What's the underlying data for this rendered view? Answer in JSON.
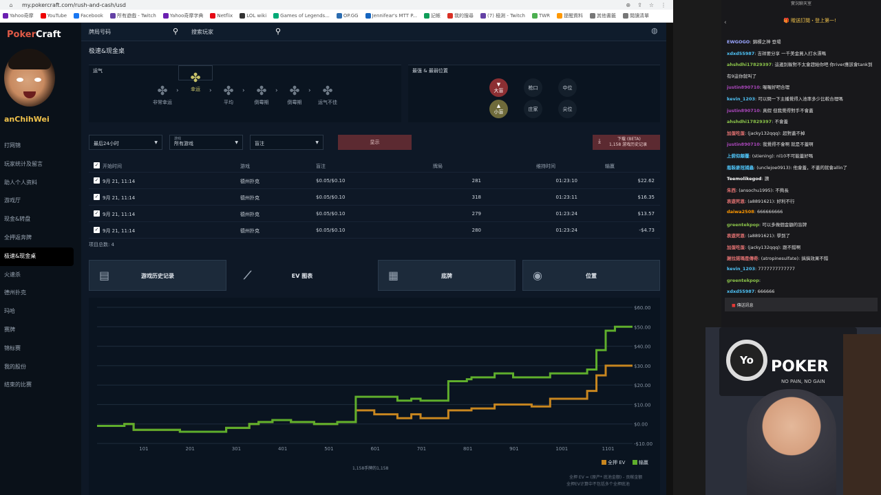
{
  "browser": {
    "url": "my.pokercraft.com/rush-and-cash/usd",
    "bookmarks": [
      "Yahoo奇摩",
      "YouTube",
      "Facebook",
      "所有遊戲 - Twitch",
      "Yahoo奇摩字典",
      "Netflix",
      "LOL wiki",
      "Games of Legends...",
      "OP.GG",
      "Jennifear's MTT P...",
      "記帳",
      "我的搜尋",
      "(7) 極測 - Twitch",
      "TWR",
      "提醒資料",
      "其他書籤",
      "閱讀清單"
    ]
  },
  "app": {
    "logo_a": "Poker",
    "logo_b": "Craft",
    "username": "anChihWei",
    "sidebar": [
      {
        "label": "打网锦"
      },
      {
        "label": "玩家统计及留言"
      },
      {
        "label": "助人个人资料"
      },
      {
        "label": "游戏厅"
      },
      {
        "label": "现金&转盘"
      },
      {
        "label": "全押返奔牌"
      },
      {
        "label": "极速&现金桌",
        "active": true
      },
      {
        "label": "火速杀"
      },
      {
        "label": "德州扑克"
      },
      {
        "label": "玛哈"
      },
      {
        "label": "赛牌"
      },
      {
        "label": "锦标赛"
      },
      {
        "label": "我的股份"
      },
      {
        "label": "结束的比赛"
      }
    ],
    "topbar": {
      "hand_number": "牌局号码",
      "search_player": "搜索玩家"
    },
    "page_title": "极速&现金桌",
    "luck": {
      "title": "运气",
      "steps": [
        "非常幸运",
        "幸运",
        "平均",
        "倒霉期",
        "倒霉期",
        "运气不佳"
      ],
      "selected_index": 1
    },
    "positions": {
      "title": "最强 & 最弱位置",
      "big_blind": "大盲",
      "small_blind": "小盲",
      "cutoff": "枪口",
      "middle": "中位",
      "dealer": "庄家",
      "utg": "尖位"
    },
    "filters": {
      "period": "最后24小时",
      "game_small": "游戏",
      "game": "所有游戏",
      "stakes": "盲注",
      "show": "显示",
      "download_a": "下载 (BETA)",
      "download_b": "1,158 游戏历史记录"
    },
    "table": {
      "headers": [
        "开始时间",
        "游戏",
        "盲注",
        "牌局",
        "维持时间",
        "输赢"
      ],
      "rows": [
        {
          "start": "9月 21, 11:14",
          "game": "德州扑克",
          "stakes": "$0.05/$0.10",
          "hands": "281",
          "duration": "01:23:10",
          "result": "$22.62"
        },
        {
          "start": "9月 21, 11:14",
          "game": "德州扑克",
          "stakes": "$0.05/$0.10",
          "hands": "318",
          "duration": "01:23:11",
          "result": "$16.35"
        },
        {
          "start": "9月 21, 11:14",
          "game": "德州扑克",
          "stakes": "$0.05/$0.10",
          "hands": "279",
          "duration": "01:23:24",
          "result": "$13.57"
        },
        {
          "start": "9月 21, 11:14",
          "game": "德州扑克",
          "stakes": "$0.05/$0.10",
          "hands": "280",
          "duration": "01:23:24",
          "result": "-$4.73"
        }
      ],
      "count": "项目总数: 4"
    },
    "tabs": [
      "游戏历史记录",
      "EV 图表",
      "底牌",
      "位置"
    ],
    "tab_icons": [
      "history-icon",
      "chart-icon",
      "grid-icon",
      "position-icon"
    ],
    "active_tab": 1
  },
  "chart_data": {
    "type": "line",
    "xlabel": "1,158手牌的1,158",
    "ylabel": "",
    "x_ticks": [
      "101",
      "201",
      "301",
      "401",
      "501",
      "601",
      "701",
      "801",
      "901",
      "1001",
      "1101"
    ],
    "y_ticks": [
      "$60.00",
      "$50.00",
      "$40.00",
      "$30.00",
      "$20.00",
      "$10.00",
      "$0.00",
      "-$10.00"
    ],
    "ylim": [
      -10,
      60
    ],
    "xlim": [
      1,
      1158
    ],
    "grid": true,
    "legend_position": "bottom-right",
    "colors": {
      "ev": "#c8861f",
      "winnings": "#5fae2c"
    },
    "series": [
      {
        "name": "全押 EV",
        "x": [
          1,
          60,
          80,
          180,
          280,
          330,
          350,
          380,
          420,
          470,
          520,
          560,
          600,
          650,
          680,
          700,
          760,
          800,
          810,
          860,
          900,
          940,
          980,
          1020,
          1060,
          1080,
          1100,
          1120,
          1158
        ],
        "values": [
          -1,
          0,
          -3,
          -4,
          -2,
          0,
          1,
          2,
          1,
          0,
          1,
          7,
          5,
          3,
          5,
          3,
          7,
          7,
          8,
          10,
          10,
          9,
          13,
          13,
          17,
          25,
          30,
          30,
          30
        ]
      },
      {
        "name": "输赢",
        "x": [
          1,
          60,
          80,
          180,
          280,
          330,
          350,
          380,
          420,
          470,
          520,
          560,
          600,
          650,
          680,
          700,
          760,
          800,
          810,
          860,
          900,
          940,
          980,
          1020,
          1060,
          1080,
          1100,
          1120,
          1158
        ],
        "values": [
          -1,
          0,
          -3,
          -4,
          -2,
          0,
          1,
          2,
          1,
          0,
          1,
          14,
          14,
          12,
          13,
          12,
          22,
          23,
          24,
          26,
          24,
          24,
          26,
          26,
          28,
          38,
          48,
          50,
          50
        ]
      }
    ],
    "footnote_a": "全押 EV = (原产* 底池金额) - 贡献金额",
    "footnote_b": "全押EV计算中不包括多个全押底池",
    "y_values_note": ""
  },
  "stream": {
    "chat_title": "實況聊天室",
    "gift_text": "贈送訂閱・登上第一!",
    "messages": [
      {
        "user": "EWGOGO",
        "text": "錦標之神 登場",
        "color": "#9aa6ff"
      },
      {
        "user": "xdxd55987",
        "text": "吉祥要分享 一千美金買入打水漂嗎",
        "color": "#4fc3f7"
      },
      {
        "user": "ahshdhi17829397",
        "text": "這邊別躲對不太會趕給你吧 你river應該會tank到",
        "color": "#8bc34a"
      },
      {
        "user": "",
        "text": "有9這你就叫了",
        "color": "#fff"
      },
      {
        "user": "justin890710",
        "text": "喔喔好吧合理",
        "color": "#ab47bc"
      },
      {
        "user": "kevin_1203",
        "text": "可以問一下主播覺得入池率多少比較合理嗎",
        "color": "#4fc3f7"
      },
      {
        "user": "justin890710",
        "text": "真假 但我覺得對手不會蓋",
        "color": "#ab47bc"
      },
      {
        "user": "ahshdhi17829397",
        "text": "不會蓋",
        "color": "#8bc34a"
      },
      {
        "user": "加蛋吃蛋",
        "text": "(jacky132qqq): 超對蓋不掉",
        "color": "#e57373"
      },
      {
        "user": "justin890710",
        "text": "我覺得不會啊 就是不蓋啊",
        "color": "#ab47bc"
      },
      {
        "user": "上俯仰顛覆",
        "text": "(stiening): nl10不可能蓋好嗎",
        "color": "#4fc3f7"
      },
      {
        "user": "瓶裝麥冠捕蟲",
        "text": "(unclejoe0913): 他會蓋，不蓋的就會allin了",
        "color": "#4fc3f7"
      },
      {
        "user": "Teemolikegod",
        "text": "讚",
        "color": "#fff"
      },
      {
        "user": "朱西",
        "text": "(ansochu1995): 不夠長",
        "color": "#e57373"
      },
      {
        "user": "哀遊死恩",
        "text": "(a8891621): 好利不行",
        "color": "#e57373"
      },
      {
        "user": "daiwa2508",
        "text": "666666666",
        "color": "#ff9800"
      },
      {
        "user": "greentekpop",
        "text": "可以多做個金額的盲牌",
        "color": "#8bc34a"
      },
      {
        "user": "哀遊死恩",
        "text": "(a8891621): 學到了",
        "color": "#e57373"
      },
      {
        "user": "加蛋吃蛋",
        "text": "(jacky132qqq): 跟不錯啊",
        "color": "#e57373"
      },
      {
        "user": "謝拉諾瑪是傳奇",
        "text": "(atropinesulfate): 搞搞效果不錯",
        "color": "#e57373"
      },
      {
        "user": "kevin_1203",
        "text": "7777777777777",
        "color": "#4fc3f7"
      },
      {
        "user": "greentekpop",
        "text": "",
        "color": "#8bc34a"
      },
      {
        "user": "xdxd55987",
        "text": "666666",
        "color": "#4fc3f7"
      }
    ],
    "input_placeholder": "傳送訊息",
    "cam_brand": "POKER",
    "cam_chip": "Yo",
    "cam_sub": "NO PAIN, NO GAIN"
  }
}
